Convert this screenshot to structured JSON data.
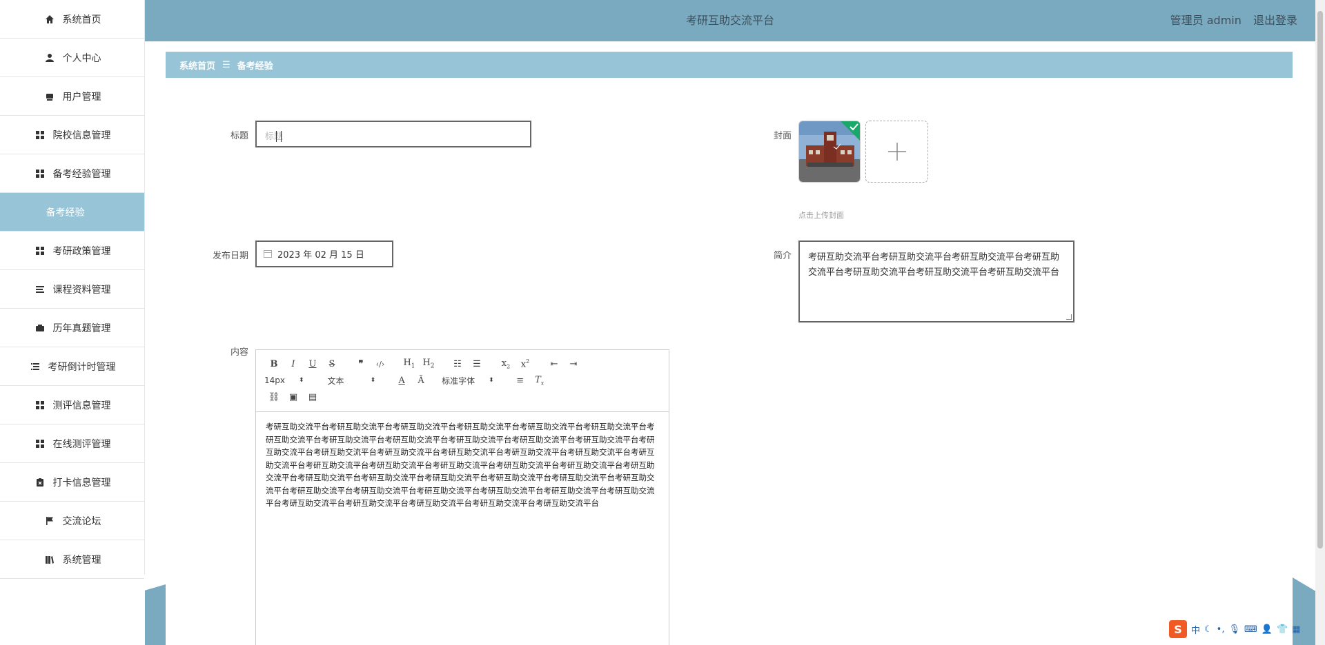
{
  "app": {
    "title": "考研互助交流平台",
    "user_label": "管理员 admin",
    "logout_label": "退出登录"
  },
  "sidebar": {
    "items": [
      {
        "label": "系统首页",
        "icon": "home-icon"
      },
      {
        "label": "个人中心",
        "icon": "user-icon"
      },
      {
        "label": "用户管理",
        "icon": "users-icon"
      },
      {
        "label": "院校信息管理",
        "icon": "grid-icon"
      },
      {
        "label": "备考经验管理",
        "icon": "grid-icon"
      },
      {
        "label": "备考经验",
        "icon": "",
        "active": true
      },
      {
        "label": "考研政策管理",
        "icon": "grid-icon"
      },
      {
        "label": "课程资料管理",
        "icon": "list-icon"
      },
      {
        "label": "历年真题管理",
        "icon": "wallet-icon"
      },
      {
        "label": "考研倒计时管理",
        "icon": "list-indent-icon"
      },
      {
        "label": "测评信息管理",
        "icon": "grid-icon"
      },
      {
        "label": "在线测评管理",
        "icon": "grid-icon"
      },
      {
        "label": "打卡信息管理",
        "icon": "clipboard-icon"
      },
      {
        "label": "交流论坛",
        "icon": "flag-icon"
      },
      {
        "label": "系统管理",
        "icon": "book-icon"
      }
    ]
  },
  "breadcrumb": {
    "home": "系统首页",
    "separator": "☰",
    "current": "备考经验"
  },
  "form": {
    "title_label": "标题",
    "title_placeholder": "标题",
    "cover_label": "封面",
    "cover_tip": "点击上传封面",
    "date_label": "发布日期",
    "date_value": "2023 年 02 月 15 日",
    "summary_label": "简介",
    "summary_value": "考研互助交流平台考研互助交流平台考研互助交流平台考研互助交流平台考研互助交流平台考研互助交流平台考研互助交流平台",
    "content_label": "内容"
  },
  "editor": {
    "font_size": "14px",
    "block_type": "文本",
    "font_family": "标准字体",
    "body": "考研互助交流平台考研互助交流平台考研互助交流平台考研互助交流平台考研互助交流平台考研互助交流平台考研互助交流平台考研互助交流平台考研互助交流平台考研互助交流平台考研互助交流平台考研互助交流平台考研互助交流平台考研互助交流平台考研互助交流平台考研互助交流平台考研互助交流平台考研互助交流平台考研互助交流平台考研互助交流平台考研互助交流平台考研互助交流平台考研互助交流平台考研互助交流平台考研互助交流平台考研互助交流平台考研互助交流平台考研互助交流平台考研互助交流平台考研互助交流平台考研互助交流平台考研互助交流平台考研互助交流平台考研互助交流平台考研互助交流平台考研互助交流平台考研互助交流平台考研互助交流平台考研互助交流平台考研互助交流平台考研互助交流平台考研互助交流平台"
  },
  "ime": {
    "mode": "中"
  },
  "colors": {
    "header": "#79aabf",
    "accent": "#97c4d6"
  }
}
